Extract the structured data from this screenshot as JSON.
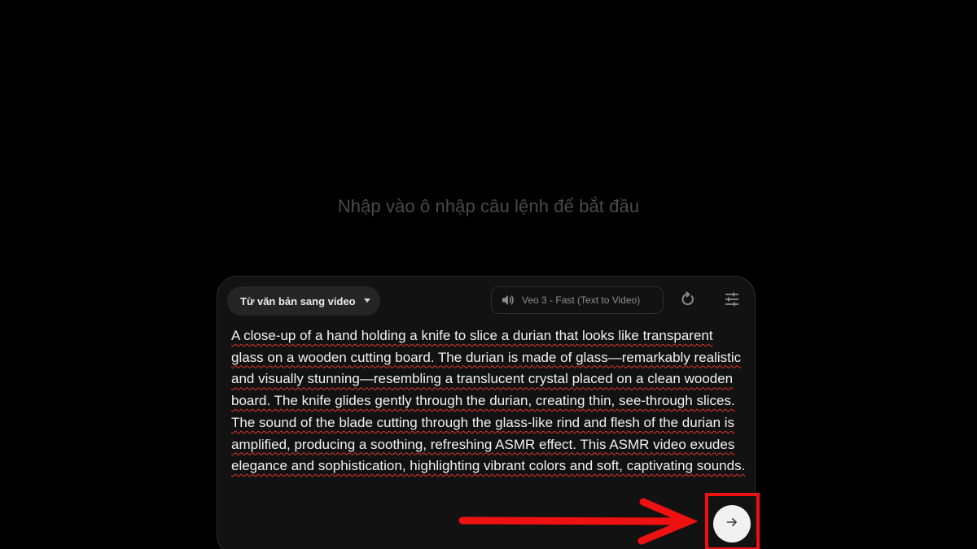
{
  "hint": {
    "text": "Nhập vào ô nhập câu lệnh để bắt đầu"
  },
  "composer": {
    "mode_label": "Từ văn bản sang video",
    "mode_icon": "caret-down-icon",
    "model_label": "Veo 3 - Fast (Text to Video)",
    "model_icon": "speaker-icon",
    "loop_icon": "refresh-icon",
    "settings_icon": "sliders-icon",
    "prompt": "A close-up of a hand holding a knife to slice a durian that looks like transparent glass on a wooden cutting board. The durian is made of glass—remarkably realistic and visually stunning—resembling a translucent crystal placed on a clean wooden board. The knife glides gently through the durian, creating thin, see-through slices. The sound of the blade cutting through the glass-like rind and flesh of the durian is amplified, producing a soothing, refreshing ASMR effect. This ASMR video exudes elegance and sophistication, highlighting vibrant colors and soft, captivating sounds.",
    "send_icon": "arrow-right-icon"
  },
  "annotation": {
    "color": "#ee1111",
    "arrow_icon": "red-arrow-icon",
    "box": "highlight-box"
  },
  "colors": {
    "background": "#000000",
    "panel": "#121212",
    "spellcheck": "#e0352b"
  }
}
